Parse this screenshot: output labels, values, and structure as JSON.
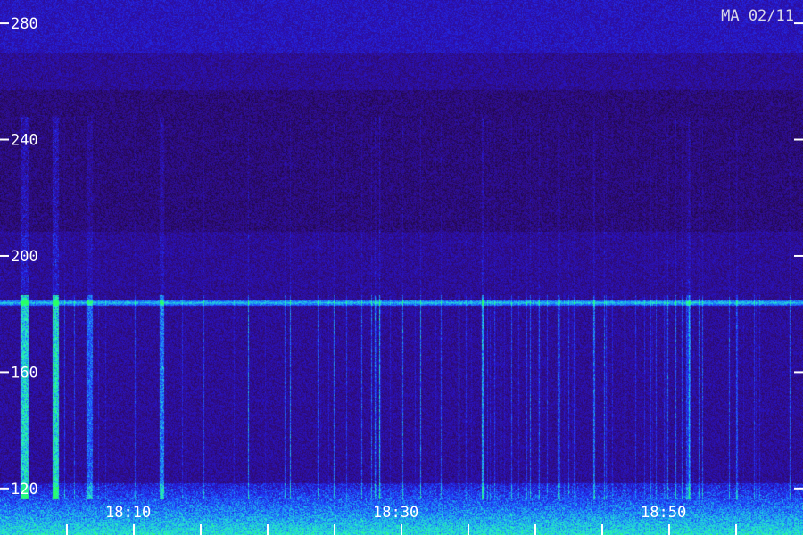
{
  "station_label": "MA 02/11",
  "chart_data": {
    "type": "heatmap",
    "title": "",
    "xlabel": "",
    "ylabel": "",
    "y_ticks": [
      120,
      160,
      200,
      240,
      280
    ],
    "ylim": [
      104,
      288
    ],
    "x_ticks": [
      "18:10",
      "18:30",
      "18:50"
    ],
    "x_range": [
      "18:00",
      "19:00"
    ],
    "minor_x_ticks": [
      "18:05",
      "18:10",
      "18:15",
      "18:20",
      "18:25",
      "18:30",
      "18:35",
      "18:40",
      "18:45",
      "18:50",
      "18:55"
    ],
    "features": {
      "horizontal_band_y": 184,
      "noise_floor_top_y": 122
    },
    "colors": {
      "background": "#1a0630",
      "low": "#3a0f8a",
      "mid": "#1a3cff",
      "high": "#22c8e8",
      "peak": "#00ff80"
    }
  }
}
